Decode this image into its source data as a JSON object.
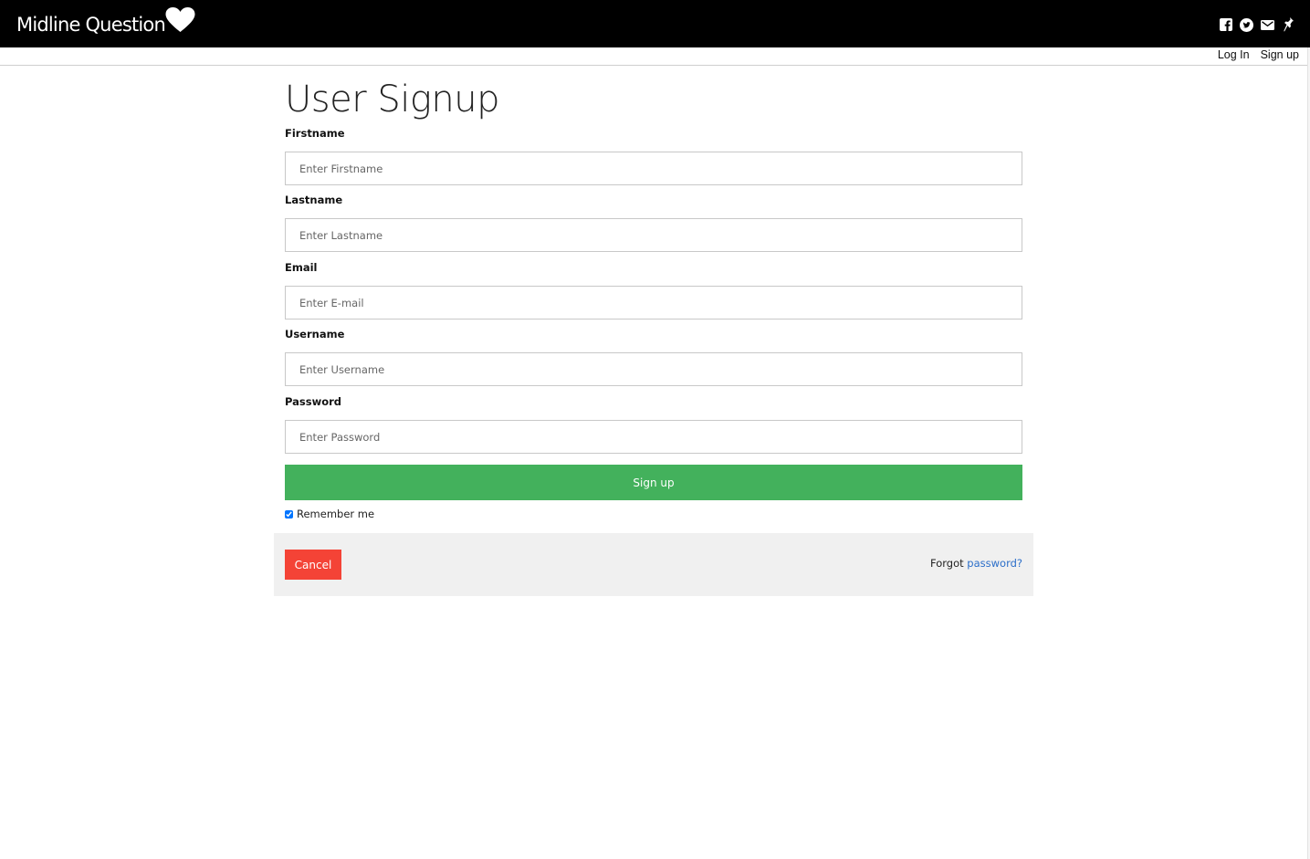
{
  "brand": {
    "name": "Midline Question",
    "icon": "heart-icon"
  },
  "social": {
    "icons": [
      "facebook-icon",
      "twitter-icon",
      "mail-icon",
      "pin-icon"
    ]
  },
  "nav": {
    "login_label": "Log In",
    "signup_label": "Sign up"
  },
  "page": {
    "title": "User Signup"
  },
  "form": {
    "firstname": {
      "label": "Firstname",
      "placeholder": "Enter Firstname",
      "value": ""
    },
    "lastname": {
      "label": "Lastname",
      "placeholder": "Enter Lastname",
      "value": ""
    },
    "email": {
      "label": "Email",
      "placeholder": "Enter E-mail",
      "value": ""
    },
    "username": {
      "label": "Username",
      "placeholder": "Enter Username",
      "value": ""
    },
    "password": {
      "label": "Password",
      "placeholder": "Enter Password",
      "value": ""
    },
    "submit_label": "Sign up",
    "remember_label": "Remember me",
    "remember_checked": true
  },
  "footer": {
    "cancel_label": "Cancel",
    "forgot_prefix": "Forgot",
    "forgot_link": "password?"
  },
  "colors": {
    "topbar": "#000000",
    "submit": "#43b15c",
    "cancel": "#f44336",
    "link": "#2b6ec9",
    "footer_bg": "#f0f0f0"
  }
}
